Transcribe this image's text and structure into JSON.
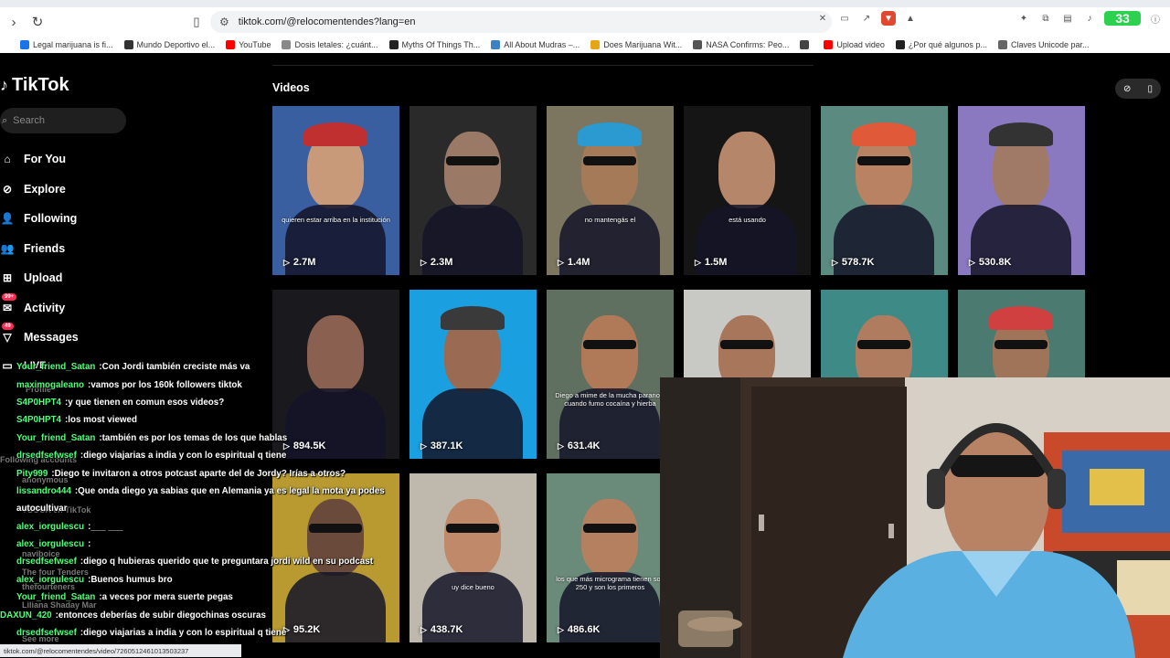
{
  "browser": {
    "url": "tiktok.com/@relocomentendes?lang=en",
    "extension_badge": "33",
    "bookmarks": [
      {
        "label": "Legal marijuana is fi...",
        "color": "#1a73e8"
      },
      {
        "label": "Mundo Deportivo el...",
        "color": "#333333"
      },
      {
        "label": "YouTube",
        "color": "#ff0000"
      },
      {
        "label": "Dosis letales: ¿cuánt...",
        "color": "#888888"
      },
      {
        "label": "Myths Of Things Th...",
        "color": "#222222"
      },
      {
        "label": "All About Mudras –...",
        "color": "#3b82c4"
      },
      {
        "label": "Does Marijuana Wit...",
        "color": "#e8a317"
      },
      {
        "label": "NASA Confirms: Peo...",
        "color": "#555555"
      },
      {
        "label": "",
        "color": "#444444"
      },
      {
        "label": "Upload video",
        "color": "#ff0000"
      },
      {
        "label": "¿Por qué algunos p...",
        "color": "#222222"
      },
      {
        "label": "Claves Unicode par...",
        "color": "#666666"
      }
    ]
  },
  "tiktok": {
    "logo": "TikTok",
    "search_placeholder": "Search",
    "nav": [
      {
        "label": "For You",
        "icon": "home-icon",
        "glyph": "⌂"
      },
      {
        "label": "Explore",
        "icon": "compass-icon",
        "glyph": "⊘"
      },
      {
        "label": "Following",
        "icon": "following-icon",
        "glyph": "👤"
      },
      {
        "label": "Friends",
        "icon": "friends-icon",
        "glyph": "👥"
      },
      {
        "label": "Upload",
        "icon": "upload-icon",
        "glyph": "⊞"
      },
      {
        "label": "Activity",
        "icon": "activity-icon",
        "glyph": "✉",
        "badge": "99+"
      },
      {
        "label": "Messages",
        "icon": "messages-icon",
        "glyph": "▽",
        "badge": "49"
      }
    ],
    "live_label": "LIVE",
    "section_title": "Videos",
    "videos": [
      {
        "views": "2.7M",
        "caption": "quieren estar arriba en la institución",
        "bg": "#3a5fa0",
        "skin": "#c99a7a",
        "shades": false,
        "hat": "#c03030"
      },
      {
        "views": "2.3M",
        "caption": "",
        "bg": "#2a2a2a",
        "skin": "#9a7a66",
        "shades": true,
        "hat": ""
      },
      {
        "views": "1.4M",
        "caption": "no mantengás el",
        "bg": "#7c7660",
        "skin": "#a47a58",
        "shades": true,
        "hat": "#2a9ad0"
      },
      {
        "views": "1.5M",
        "caption": "está usando",
        "bg": "#151515",
        "skin": "#b6866a",
        "shades": false,
        "hat": ""
      },
      {
        "views": "578.7K",
        "caption": "",
        "bg": "#5a8a80",
        "skin": "#b98262",
        "shades": true,
        "hat": "#e05a3a"
      },
      {
        "views": "530.8K",
        "caption": "",
        "bg": "#8a78c0",
        "skin": "#a07a66",
        "shades": false,
        "hat": "#333333"
      },
      {
        "views": "894.5K",
        "caption": "",
        "bg": "#1a1a1e",
        "skin": "#8a6050",
        "shades": false,
        "hat": ""
      },
      {
        "views": "387.1K",
        "caption": "",
        "bg": "#1aa0e0",
        "skin": "#9a6a52",
        "shades": false,
        "hat": "#3a3a3a"
      },
      {
        "views": "631.4K",
        "caption": "Diego a mime de la mucha paranoia cuando fumo cocaína y hierba",
        "bg": "#607060",
        "skin": "#b07a58",
        "shades": true,
        "hat": ""
      },
      {
        "views": "",
        "caption": "",
        "bg": "#c8c8c4",
        "skin": "#a8765a",
        "shades": true,
        "hat": ""
      },
      {
        "views": "",
        "caption": "",
        "bg": "#3e8a86",
        "skin": "#b07c60",
        "shades": true,
        "hat": ""
      },
      {
        "views": "",
        "caption": "",
        "bg": "#4a7a70",
        "skin": "#a07458",
        "shades": true,
        "hat": "#d04040"
      },
      {
        "views": "95.2K",
        "caption": "",
        "bg": "#b89a30",
        "skin": "#6a4a3a",
        "shades": true,
        "hat": ""
      },
      {
        "views": "438.7K",
        "caption": "uy dice bueno",
        "bg": "#bfb8ad",
        "skin": "#c08a6a",
        "shades": true,
        "hat": ""
      },
      {
        "views": "486.6K",
        "caption": "los que más micrograma tienen son 250 y son los primeros",
        "bg": "#6a8a7a",
        "skin": "#b48060",
        "shades": true,
        "hat": ""
      }
    ]
  },
  "chat": [
    {
      "user": "Your_friend_Satan",
      "text": "Con Jordi también creciste más va",
      "indent": true
    },
    {
      "user": "maximogaleano",
      "text": "vamos por los 160k followers tiktok",
      "indent": true
    },
    {
      "user": "S4P0HPT4",
      "text": "y que tienen en comun esos videos?",
      "indent": true
    },
    {
      "user": "S4P0HPT4",
      "text": "los most viewed",
      "indent": true
    },
    {
      "user": "Your_friend_Satan",
      "text": "también es por los temas de los que hablas",
      "indent": true
    },
    {
      "user": "drsedfsefwsef",
      "text": "diego viajarias a india y con lo espiritual q tiene",
      "indent": true
    },
    {
      "user": "Pity999",
      "text": "Diego te invitaron a otros potcast aparte del de Jordy? Irías a otros?",
      "indent": true
    },
    {
      "user": "lissandro444",
      "text": "Que onda diego ya sabias que en Alemania ya es legal la mota ya podes",
      "indent": true
    },
    {
      "user": "",
      "text": "autocultivar",
      "indent": true
    },
    {
      "user": "alex_iorgulescu",
      "text": "___ ___",
      "indent": true
    },
    {
      "user": "alex_iorgulescu",
      "text": "",
      "indent": true
    },
    {
      "user": "drsedfsefwsef",
      "text": "diego q hubieras querido que te preguntara jordi wild en su podcast",
      "indent": true
    },
    {
      "user": "alex_iorgulescu",
      "text": "Buenos humus bro",
      "indent": true
    },
    {
      "user": "Your_friend_Satan",
      "text": "a veces por mera suerte pegas",
      "indent": true
    },
    {
      "user": "DAXUN_420",
      "text": "entonces deberías de subir diegochinas oscuras",
      "indent": false
    },
    {
      "user": "drsedfsefwsef",
      "text": "diego viajarias a india y con lo espiritual q tiene",
      "indent": true
    }
  ],
  "status_url": "tiktok.com/@relocomentendes/video/7260512461013503237",
  "ghost_labels": [
    "Profile",
    "Following accounts",
    "anonymous",
    "naviboice",
    "YSOCA en TikTok",
    "The four Tenders",
    "thefourteners",
    "Liliana Shaday Mar",
    "See more"
  ]
}
